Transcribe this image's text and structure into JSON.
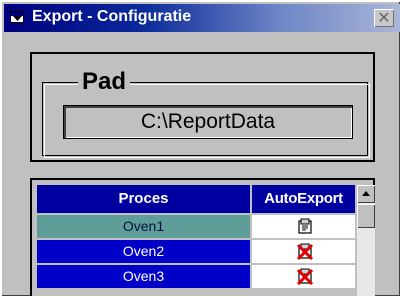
{
  "window": {
    "title": "Export - Configuratie",
    "close_glyph": "✕"
  },
  "pad": {
    "legend": "Pad",
    "value": "C:\\ReportData"
  },
  "table": {
    "columns": [
      "Proces",
      "AutoExport"
    ],
    "rows": [
      {
        "proces": "Oven1",
        "autoexport": "enabled",
        "icon": "export-enabled-icon",
        "selected": true
      },
      {
        "proces": "Oven2",
        "autoexport": "disabled",
        "icon": "export-disabled-icon",
        "selected": false
      },
      {
        "proces": "Oven3",
        "autoexport": "disabled",
        "icon": "export-disabled-icon",
        "selected": false
      }
    ]
  },
  "colors": {
    "title_start": "#000080",
    "header": "#0000a0",
    "row_normal": "#0000c8",
    "row_selected": "#5f9e98",
    "disabled_mark": "#e00000"
  }
}
